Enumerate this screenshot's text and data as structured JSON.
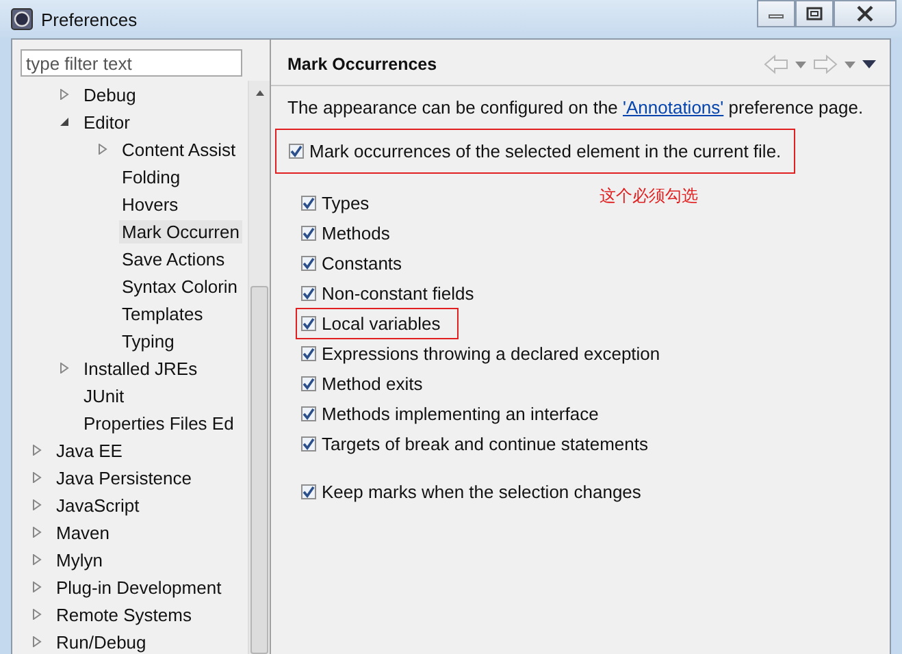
{
  "window": {
    "title": "Preferences"
  },
  "filter": {
    "placeholder": "type filter text"
  },
  "tree": {
    "cut_parent_children": [
      {
        "label": "Debug",
        "expanded": false,
        "selected": false
      },
      {
        "label": "Editor",
        "expanded": true,
        "selected": false,
        "children": [
          {
            "label": "Content Assist",
            "expanded": false,
            "selected": false
          },
          {
            "label": "Folding",
            "selected": false
          },
          {
            "label": "Hovers",
            "selected": false
          },
          {
            "label": "Mark Occurren",
            "selected": true
          },
          {
            "label": "Save Actions",
            "selected": false
          },
          {
            "label": "Syntax Colorin",
            "selected": false
          },
          {
            "label": "Templates",
            "selected": false
          },
          {
            "label": "Typing",
            "selected": false
          }
        ]
      },
      {
        "label": "Installed JREs",
        "expanded": false,
        "selected": false
      },
      {
        "label": "JUnit",
        "selected": false
      },
      {
        "label": "Properties Files Ed",
        "selected": false
      }
    ],
    "items": [
      {
        "label": "Java EE",
        "expanded": false,
        "selected": false
      },
      {
        "label": "Java Persistence",
        "expanded": false,
        "selected": false
      },
      {
        "label": "JavaScript",
        "expanded": false,
        "selected": false
      },
      {
        "label": "Maven",
        "expanded": false,
        "selected": false
      },
      {
        "label": "Mylyn",
        "expanded": false,
        "selected": false
      },
      {
        "label": "Plug-in Development",
        "expanded": false,
        "selected": false
      },
      {
        "label": "Remote Systems",
        "expanded": false,
        "selected": false
      },
      {
        "label": "Run/Debug",
        "expanded": false,
        "selected": false
      }
    ]
  },
  "page": {
    "title": "Mark Occurrences",
    "description": {
      "before": "The appearance can be configured on the ",
      "link": "'Annotations'",
      "after": " preference page."
    },
    "main_option": {
      "label": "Mark occurrences of the selected element in the current file.",
      "checked": true,
      "highlighted": true
    },
    "annotation": "这个必须勾选",
    "options": [
      {
        "label": "Types",
        "checked": true,
        "highlighted": false
      },
      {
        "label": "Methods",
        "checked": true,
        "highlighted": false
      },
      {
        "label": "Constants",
        "checked": true,
        "highlighted": false
      },
      {
        "label": "Non-constant fields",
        "checked": true,
        "highlighted": false
      },
      {
        "label": "Local variables",
        "checked": true,
        "highlighted": true
      },
      {
        "label": "Expressions throwing a declared exception",
        "checked": true,
        "highlighted": false
      },
      {
        "label": "Method exits",
        "checked": true,
        "highlighted": false
      },
      {
        "label": "Methods implementing an interface",
        "checked": true,
        "highlighted": false
      },
      {
        "label": "Targets of break and continue statements",
        "checked": true,
        "highlighted": false
      }
    ],
    "keep_option": {
      "label": "Keep marks when the selection changes",
      "checked": true,
      "highlighted": false
    }
  }
}
